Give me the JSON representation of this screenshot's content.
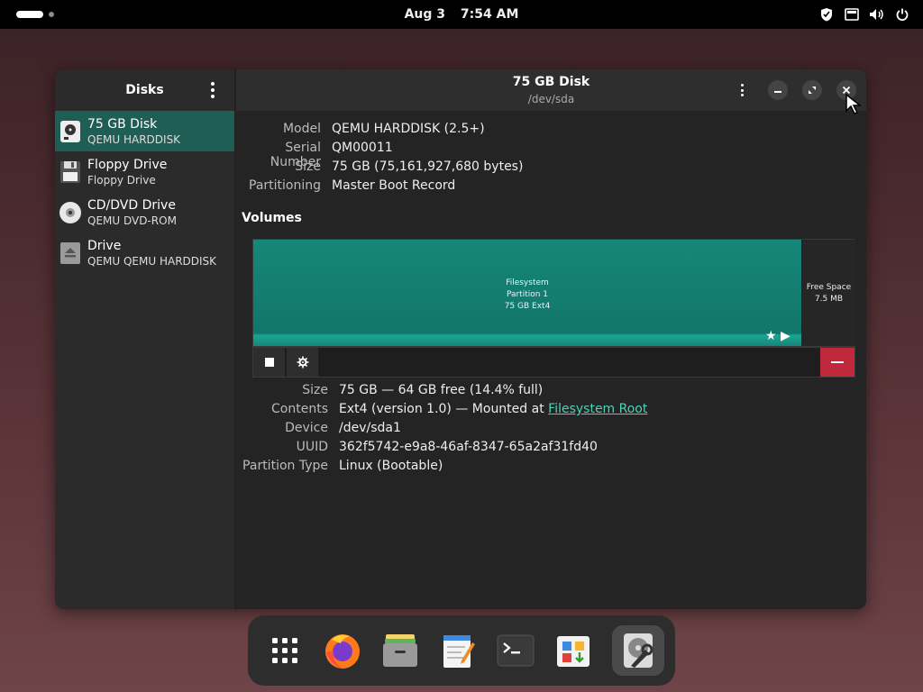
{
  "topbar": {
    "date": "Aug 3",
    "time": "7:54 AM",
    "tray_icons": [
      "shield-icon",
      "network-icon",
      "volume-icon",
      "power-icon"
    ]
  },
  "sidebar": {
    "title": "Disks",
    "devices": [
      {
        "name": "75 GB Disk",
        "sub": "QEMU HARDDISK",
        "icon": "harddisk-icon",
        "selected": true
      },
      {
        "name": "Floppy Drive",
        "sub": "Floppy Drive",
        "icon": "floppy-icon",
        "selected": false
      },
      {
        "name": "CD/DVD Drive",
        "sub": "QEMU DVD-ROM",
        "icon": "cdrom-icon",
        "selected": false
      },
      {
        "name": "Drive",
        "sub": "QEMU QEMU HARDDISK",
        "icon": "eject-drive-icon",
        "selected": false
      }
    ]
  },
  "header": {
    "title": "75 GB Disk",
    "subtitle": "/dev/sda"
  },
  "disk": {
    "model_label": "Model",
    "model": "QEMU HARDDISK (2.5+)",
    "serial_label": "Serial Number",
    "serial": "QM00011",
    "size_label": "Size",
    "size": "75 GB (75,161,927,680 bytes)",
    "partitioning_label": "Partitioning",
    "partitioning": "Master Boot Record"
  },
  "volumes": {
    "title": "Volumes",
    "partition": {
      "line1": "Filesystem",
      "line2": "Partition 1",
      "line3": "75 GB Ext4"
    },
    "free": {
      "line1": "Free Space",
      "line2": "7.5 MB"
    }
  },
  "volume_props": {
    "size_label": "Size",
    "size": "75 GB — 64 GB free (14.4% full)",
    "contents_label": "Contents",
    "contents_prefix": "Ext4 (version 1.0) — Mounted at ",
    "contents_link": "Filesystem Root",
    "device_label": "Device",
    "device": "/dev/sda1",
    "uuid_label": "UUID",
    "uuid": "362f5742-e9a8-46af-8347-65a2af31fd40",
    "ptype_label": "Partition Type",
    "ptype": "Linux (Bootable)"
  },
  "dock": {
    "apps": [
      "app-grid-icon",
      "firefox-icon",
      "files-icon",
      "text-editor-icon",
      "terminal-icon",
      "software-icon",
      "disks-icon"
    ]
  },
  "colors": {
    "accent": "#1f5e55",
    "partition": "#16877a",
    "delete": "#c0283b",
    "link": "#4fd1b8"
  }
}
